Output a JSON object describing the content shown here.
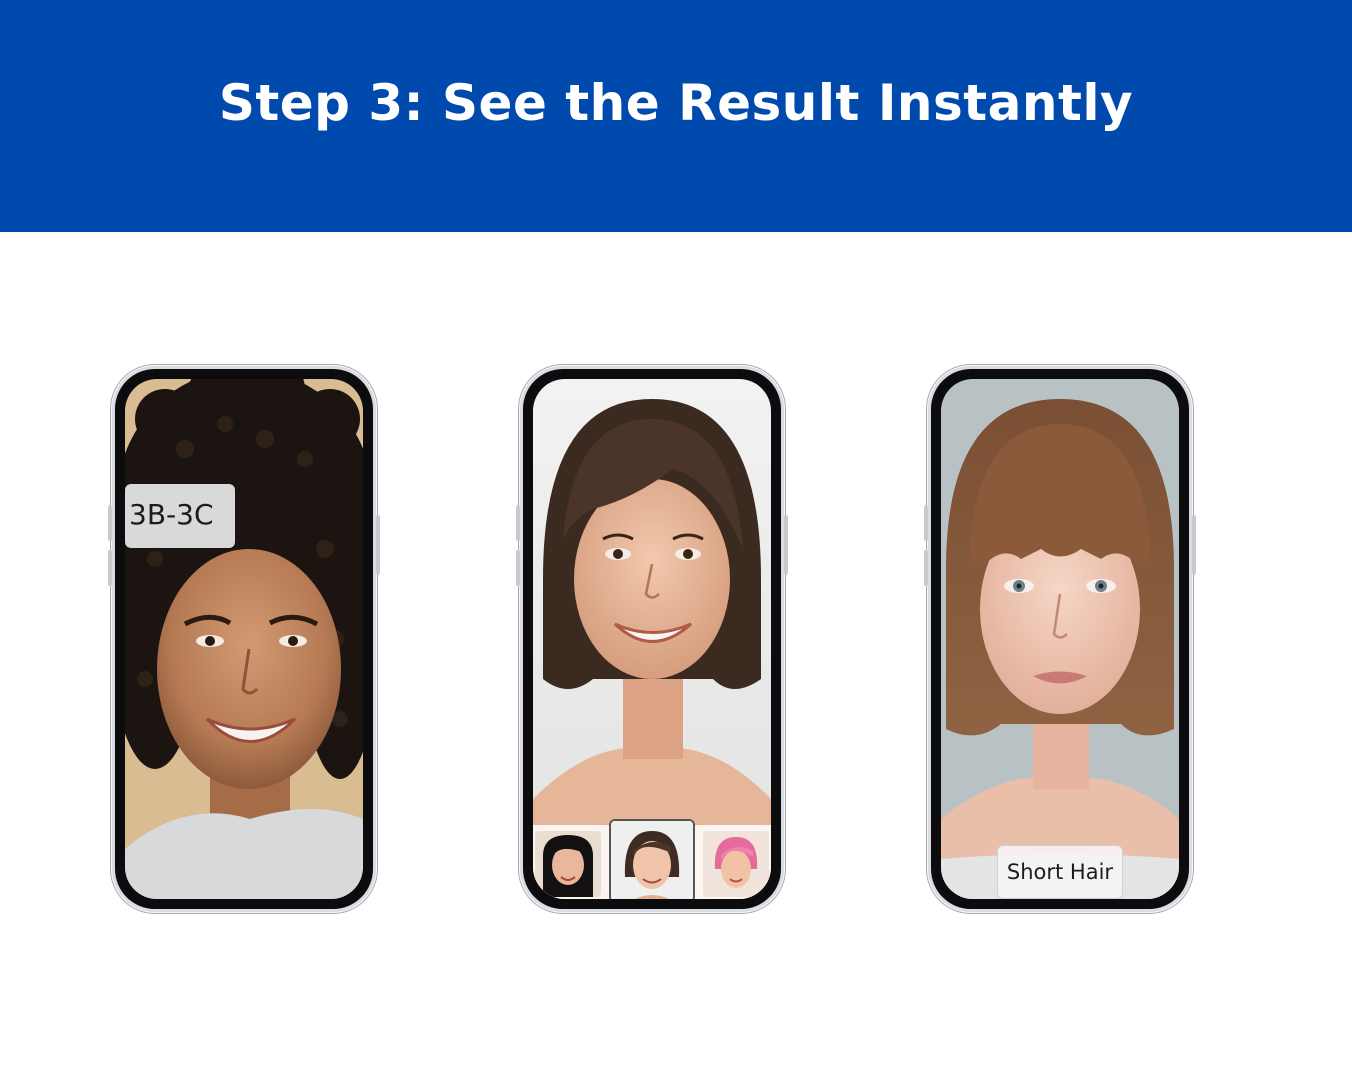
{
  "header": {
    "title": "Step 3: See the Result Instantly",
    "background": "#004aad"
  },
  "phones": [
    {
      "label": "3B-3C",
      "style": "curly dark hair",
      "backdrop": "#d9bc92"
    },
    {
      "label": "",
      "style": "dark brown bob",
      "backdrop": "#eeeeee",
      "thumbnails": [
        "black long hair",
        "dark brown bob (selected)",
        "pink short hair"
      ]
    },
    {
      "label": "Short Hair",
      "style": "chestnut bob with bangs",
      "backdrop": "#b8c2c4"
    }
  ]
}
